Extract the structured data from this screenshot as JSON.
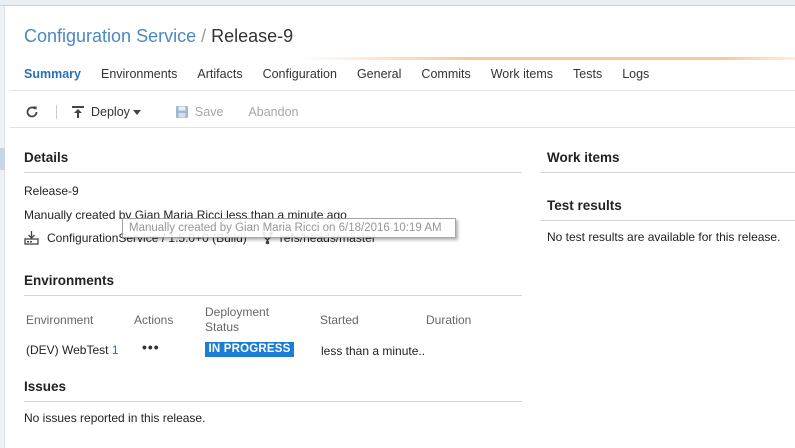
{
  "header": {
    "breadcrumb_parent": "Configuration Service",
    "separator": "/",
    "current": "Release-9"
  },
  "tabs": [
    {
      "label": "Summary",
      "active": true
    },
    {
      "label": "Environments",
      "active": false
    },
    {
      "label": "Artifacts",
      "active": false
    },
    {
      "label": "Configuration",
      "active": false
    },
    {
      "label": "General",
      "active": false
    },
    {
      "label": "Commits",
      "active": false
    },
    {
      "label": "Work items",
      "active": false
    },
    {
      "label": "Tests",
      "active": false
    },
    {
      "label": "Logs",
      "active": false
    }
  ],
  "toolbar": {
    "refresh_icon": "refresh-icon",
    "deploy_label": "Deploy",
    "save_label": "Save",
    "abandon_label": "Abandon"
  },
  "details": {
    "title": "Details",
    "release_name": "Release-9",
    "created_text": "Manually created by Gian Maria Ricci less than a minute ago",
    "build_artifact": "ConfigurationService / 1.5.0+0 (Build)",
    "branch": "refs/heads/master",
    "tooltip": "Manually created by Gian Maria Ricci on 6/18/2016 10:19 AM"
  },
  "environments": {
    "title": "Environments",
    "columns": {
      "environment": "Environment",
      "actions": "Actions",
      "status_line1": "Deployment",
      "status_line2": "Status",
      "started": "Started",
      "duration": "Duration"
    },
    "rows": [
      {
        "name": "(DEV) WebTest",
        "count": "1",
        "actions": "•••",
        "status": "IN PROGRESS",
        "started": "less than a minute..",
        "duration": ""
      }
    ]
  },
  "issues": {
    "title": "Issues",
    "empty_text": "No issues reported in this release."
  },
  "work_items": {
    "title": "Work items"
  },
  "test_results": {
    "title": "Test results",
    "empty_text": "No test results are available for this release."
  },
  "colors": {
    "accent": "#2672b9",
    "badge": "#1a7ed4",
    "title_link": "#4a88c4",
    "header_underline": "#f6c996"
  }
}
